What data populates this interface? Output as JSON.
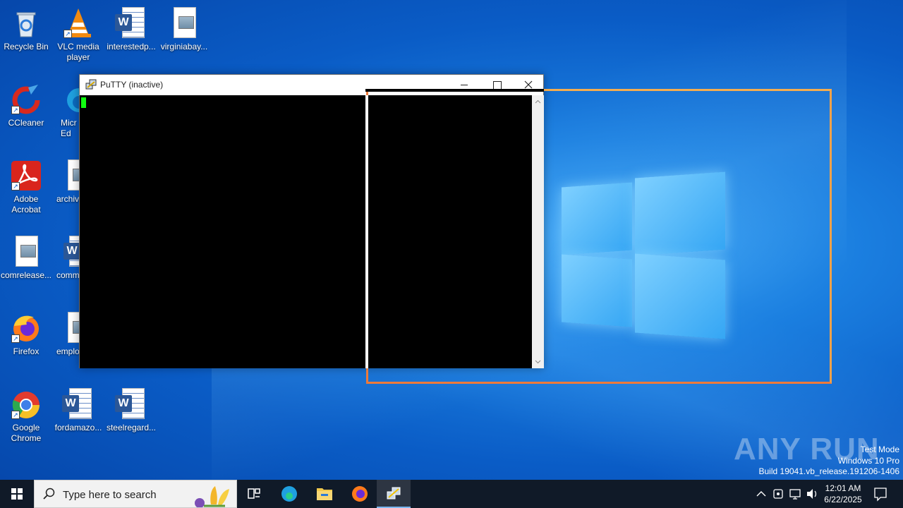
{
  "desktop": {
    "icons": [
      {
        "label": "Recycle Bin"
      },
      {
        "label": "VLC media player"
      },
      {
        "label": "interestedp..."
      },
      {
        "label": "virginiabay..."
      },
      {
        "label": "CCleaner"
      },
      {
        "label": "Micr Ed"
      },
      {
        "label": "Adobe Acrobat"
      },
      {
        "label": "archiv"
      },
      {
        "label": "comrelease..."
      },
      {
        "label": "comm"
      },
      {
        "label": "Firefox"
      },
      {
        "label": "emplo"
      },
      {
        "label": "Google Chrome"
      },
      {
        "label": "fordamazo..."
      },
      {
        "label": "steelregard..."
      }
    ]
  },
  "putty": {
    "title": "PuTTY (inactive)",
    "cursor_color": "#10ff10"
  },
  "watermark": {
    "brand": "ANY RUN",
    "line1": "Test Mode",
    "line2": "Windows 10 Pro",
    "line3": "Build 19041.vb_release.191206-1406"
  },
  "taskbar": {
    "search_placeholder": "Type here to search",
    "time": "12:01 AM",
    "date": "6/22/2025"
  },
  "colors": {
    "accent": "#0a5cc6",
    "overlay": "#f0a64a",
    "taskbar": "#101a28"
  }
}
